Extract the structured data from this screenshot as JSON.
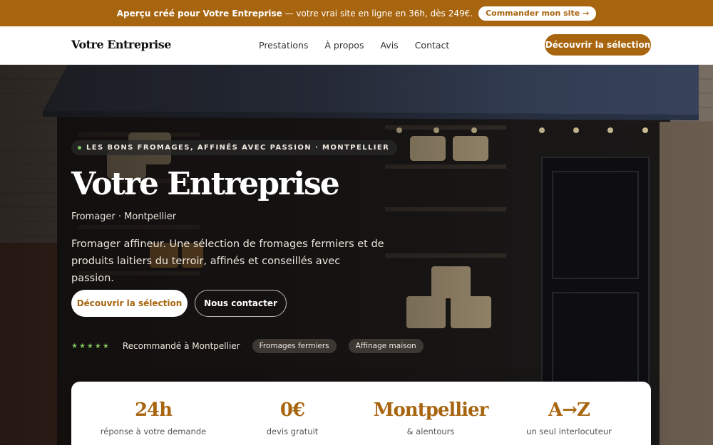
{
  "promo": {
    "lead": "Aperçu créé pour Votre Entreprise",
    "rest": " — votre vrai site en ligne en 36h, dès 249€.",
    "button": "Commander mon site →"
  },
  "nav": {
    "brand": "Votre Entreprise",
    "links": [
      "Prestations",
      "À propos",
      "Avis",
      "Contact"
    ],
    "cta": "Découvrir la sélection"
  },
  "hero": {
    "tag": "LES BONS FROMAGES, AFFINÉS AVEC PASSION · MONTPELLIER",
    "title": "Votre Entreprise",
    "subtitle": "Fromager · Montpellier",
    "description": "Fromager affineur. Une sélection de fromages fermiers et de produits laitiers du terroir, affinés et conseillés avec passion.",
    "primary_button": "Découvrir la sélection",
    "secondary_button": "Nous contacter",
    "stars": "★★★★★",
    "recommendation": "Recommandé à Montpellier",
    "chips": [
      "Fromages fermiers",
      "Affinage maison"
    ]
  },
  "stats": [
    {
      "value": "24h",
      "label": "réponse à votre demande"
    },
    {
      "value": "0€",
      "label": "devis gratuit"
    },
    {
      "value": "Montpellier",
      "label": "& alentours"
    },
    {
      "value": "A→Z",
      "label": "un seul interlocuteur"
    }
  ],
  "colors": {
    "accent": "#a8650f",
    "star": "#7cc35a"
  }
}
